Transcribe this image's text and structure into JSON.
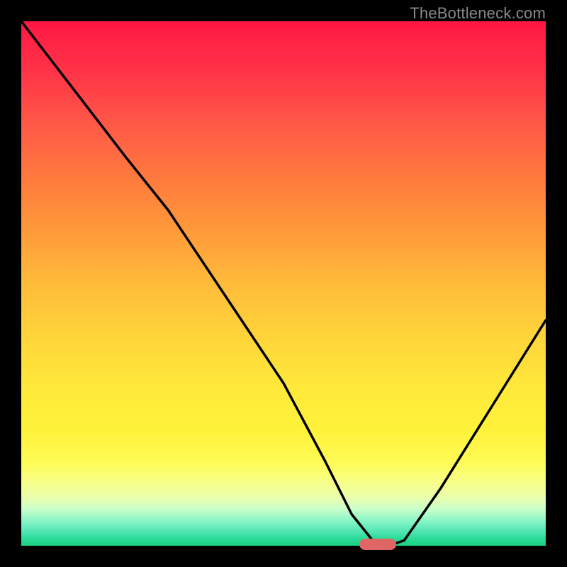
{
  "watermark": "TheBottleneck.com",
  "colors": {
    "background": "#000000",
    "gradient_top": "#ff1744",
    "gradient_mid": "#ffd43a",
    "gradient_bottom": "#1cd183",
    "curve": "#000000",
    "marker": "#e06666"
  },
  "chart_data": {
    "type": "line",
    "title": "",
    "xlabel": "",
    "ylabel": "",
    "xlim": [
      0,
      100
    ],
    "ylim": [
      0,
      100
    ],
    "x": [
      0,
      10,
      20,
      28,
      40,
      50,
      58,
      63,
      67,
      70,
      73,
      80,
      90,
      100
    ],
    "values": [
      100,
      87,
      74,
      64,
      46,
      31,
      16,
      6,
      1,
      0,
      1,
      11,
      27,
      43
    ],
    "marker": {
      "x_center": 68,
      "y": 0,
      "width": 7
    },
    "notes": "V-shaped bottleneck curve; gradient background runs red (top / 100%) to green (bottom / 0%). Y-axis implicitly represents bottleneck percentage; x-axis implicitly a hardware parameter sweep. No numeric tick labels are rendered."
  }
}
